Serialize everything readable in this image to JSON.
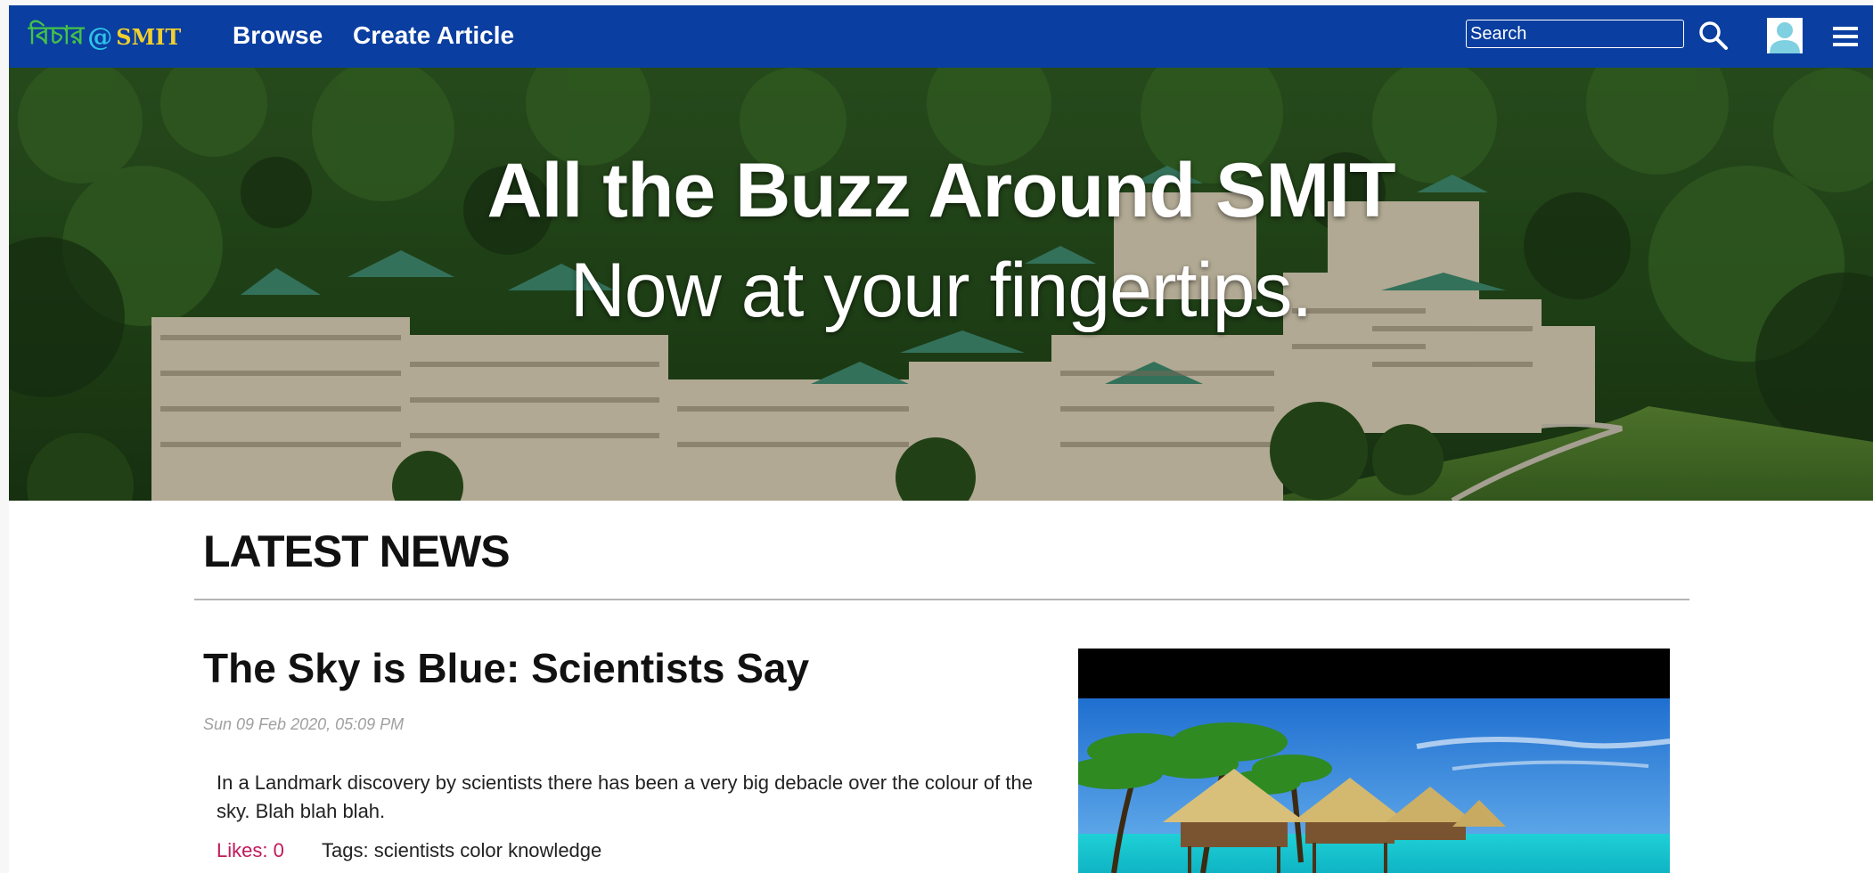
{
  "navbar": {
    "brand": {
      "script_text": "বিচার",
      "at": "@",
      "name": "SMIT"
    },
    "links": [
      {
        "label": "Browse"
      },
      {
        "label": "Create Article"
      }
    ],
    "search": {
      "placeholder": "Search",
      "value": ""
    },
    "icons": {
      "search": "search-icon",
      "user": "user-avatar-icon",
      "menu": "hamburger-menu-icon"
    },
    "colors": {
      "bar": "#0a3ea0",
      "brand_green": "#44c04a",
      "brand_cyan": "#2fc3e8",
      "brand_yellow": "#f1d02e"
    }
  },
  "hero": {
    "title": "All the Buzz Around SMIT",
    "subtitle": "Now at your fingertips."
  },
  "latest_news": {
    "heading": "LATEST NEWS",
    "articles": [
      {
        "title": "The Sky is Blue: Scientists Say",
        "date": "Sun 09 Feb 2020, 05:09 PM",
        "excerpt": "In a Landmark discovery by scientists there has been a very big debacle over the colour of the sky. Blah blah blah.",
        "likes": "Likes: 0",
        "tags": "Tags: scientists color knowledge"
      }
    ]
  },
  "colors": {
    "likes": "#c2185b",
    "date": "#a0a0a0"
  }
}
